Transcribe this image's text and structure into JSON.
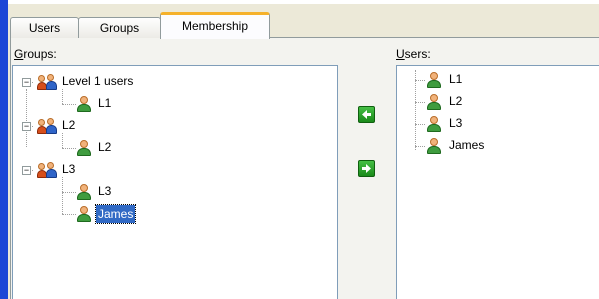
{
  "tabs": [
    {
      "label": "Users",
      "active": false
    },
    {
      "label": "Groups",
      "active": false
    },
    {
      "label": "Membership",
      "active": true
    }
  ],
  "groups_pane": {
    "label_prefix": "G",
    "label_rest": "roups:",
    "tree": [
      {
        "label": "Level 1 users",
        "expanded": true,
        "children": [
          {
            "label": "L1",
            "selected": false
          }
        ]
      },
      {
        "label": "L2",
        "expanded": true,
        "children": [
          {
            "label": "L2",
            "selected": false
          }
        ]
      },
      {
        "label": "L3",
        "expanded": true,
        "children": [
          {
            "label": "L3",
            "selected": false
          },
          {
            "label": "James",
            "selected": true
          }
        ]
      }
    ]
  },
  "users_pane": {
    "label_prefix": "U",
    "label_rest": "sers:",
    "items": [
      "L1",
      "L2",
      "L3",
      "James"
    ]
  },
  "buttons": {
    "add_icon": "arrow-left-icon",
    "remove_icon": "arrow-right-icon"
  },
  "colors": {
    "selection": "#316ac5",
    "window_frame": "#1c46d6",
    "active_tab_accent": "#f5b12b",
    "arrow_button": "#2ea42e"
  }
}
